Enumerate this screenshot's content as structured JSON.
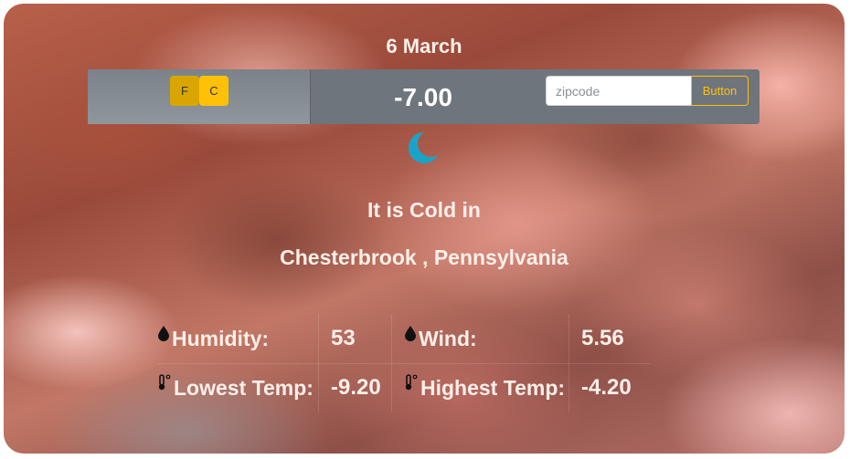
{
  "date": "6 March",
  "units": {
    "fahrenheit": "F",
    "celsius": "C"
  },
  "temperature": "-7.00",
  "search": {
    "placeholder": "zipcode",
    "button_label": "Button"
  },
  "condition_icon": "moon-icon",
  "headline": "It is Cold in",
  "location": "Chesterbrook , Pennsylvania",
  "stats": {
    "humidity_label": "Humidity:",
    "humidity_value": "53",
    "wind_label": "Wind:",
    "wind_value": "5.56",
    "low_label": "Lowest Temp:",
    "low_value": "-9.20",
    "high_label": "Highest Temp:",
    "high_value": "-4.20"
  },
  "colors": {
    "accent": "#ffc107",
    "moon": "#1aa3c9",
    "bar": "#6f757c"
  }
}
